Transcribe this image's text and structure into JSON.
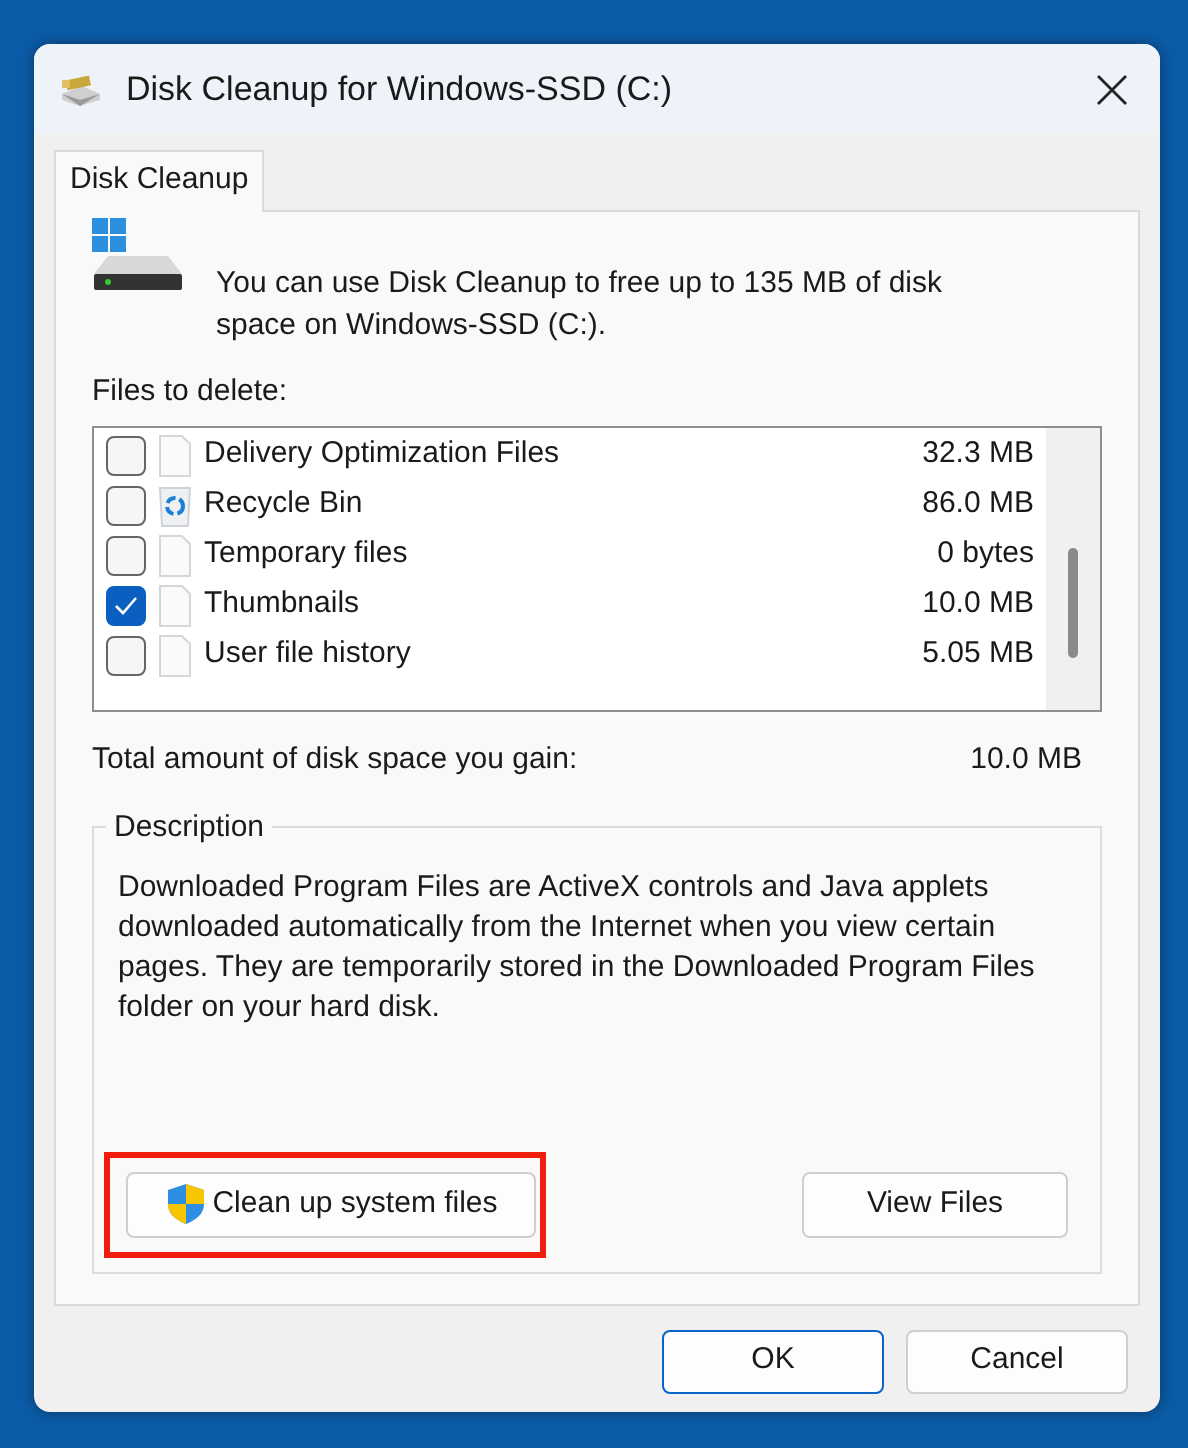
{
  "window": {
    "title": "Disk Cleanup for Windows-SSD (C:)"
  },
  "tabs": [
    {
      "label": "Disk Cleanup",
      "selected": true
    }
  ],
  "intro": "You can use Disk Cleanup to free up to 135 MB of disk space on Windows-SSD (C:).",
  "files_label": "Files to delete:",
  "files": [
    {
      "name": "Delivery Optimization Files",
      "size": "32.3 MB",
      "checked": false,
      "kind": "file"
    },
    {
      "name": "Recycle Bin",
      "size": "86.0 MB",
      "checked": false,
      "kind": "recycle"
    },
    {
      "name": "Temporary files",
      "size": "0 bytes",
      "checked": false,
      "kind": "file"
    },
    {
      "name": "Thumbnails",
      "size": "10.0 MB",
      "checked": true,
      "kind": "file"
    },
    {
      "name": "User file history",
      "size": "5.05 MB",
      "checked": false,
      "kind": "file"
    }
  ],
  "total": {
    "label": "Total amount of disk space you gain:",
    "value": "10.0 MB"
  },
  "description": {
    "title": "Description",
    "text": "Downloaded Program Files are ActiveX controls and Java applets downloaded automatically from the Internet when you view certain pages. They are temporarily stored in the Downloaded Program Files folder on your hard disk."
  },
  "actions": [
    {
      "label": "Clean up system files",
      "kind": "shield",
      "highlighted": true
    },
    {
      "label": "View Files",
      "kind": "plain",
      "highlighted": false
    }
  ],
  "buttons": [
    {
      "label": "OK",
      "default": true
    },
    {
      "label": "Cancel",
      "default": false
    }
  ]
}
